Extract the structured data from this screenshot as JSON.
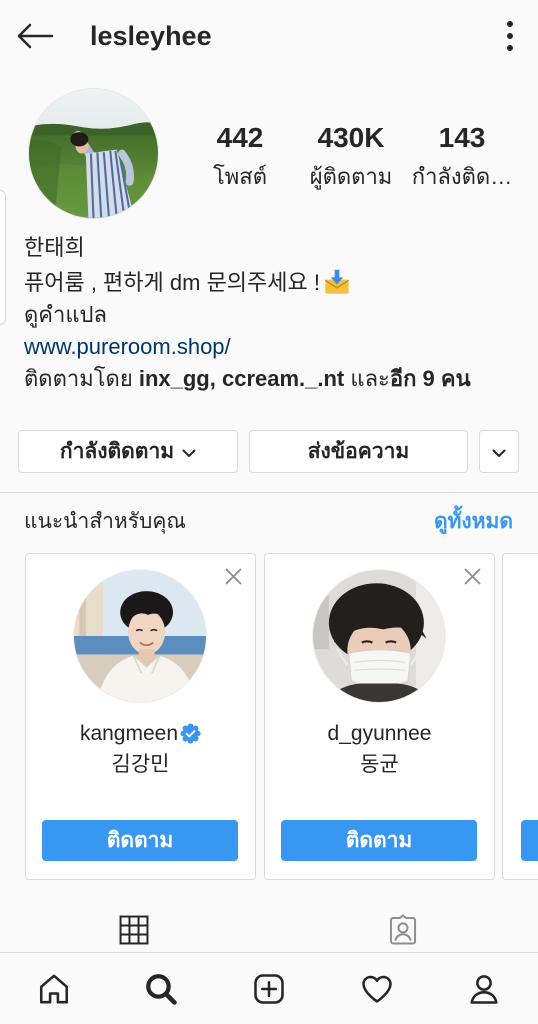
{
  "header": {
    "back_icon": "arrow-left-icon",
    "username": "lesleyhee",
    "menu_icon": "more-vertical-icon"
  },
  "profile": {
    "stats": [
      {
        "value": "442",
        "label": "โพสต์"
      },
      {
        "value": "430K",
        "label": "ผู้ติดตาม"
      },
      {
        "value": "143",
        "label": "กำลังติด…"
      }
    ],
    "bio": {
      "name": "한태희",
      "text": "퓨어룸 , 편하게 dm 문의주세요 !",
      "emoji_icon": "envelope-with-arrow-icon",
      "translate": "ดูคำแปล",
      "website": "www.pureroom.shop/"
    },
    "followed_by": {
      "prefix": "ติดตามโดย",
      "names": "inx_gg, ccream._.nt",
      "conjunction": "และ",
      "others": "อีก 9 คน"
    }
  },
  "actions": {
    "following_label": "กำลังติดตาม",
    "following_icon": "chevron-down-icon",
    "message_label": "ส่งข้อความ",
    "more_icon": "chevron-down-icon"
  },
  "suggestions": {
    "title": "แนะนำสำหรับคุณ",
    "see_all": "ดูทั้งหมด",
    "cards": [
      {
        "username": "kangmeen",
        "verified": true,
        "name": "김강민",
        "button": "ติดตาม"
      },
      {
        "username": "d_gyunnee",
        "verified": false,
        "name": "동균",
        "button": "ติดตาม"
      }
    ]
  },
  "tabs": [
    {
      "icon": "grid-icon",
      "active": true
    },
    {
      "icon": "tagged-icon",
      "active": false
    }
  ],
  "bottom_nav": [
    {
      "icon": "home-icon",
      "active": false
    },
    {
      "icon": "search-icon",
      "active": true
    },
    {
      "icon": "add-icon",
      "active": false
    },
    {
      "icon": "heart-icon",
      "active": false
    },
    {
      "icon": "profile-icon",
      "active": false
    }
  ],
  "colors": {
    "background": "#fafafa",
    "text": "#262626",
    "accent": "#3897f0",
    "link": "#003569",
    "border": "#dbdbdb",
    "muted_icon": "#8e8e8e"
  }
}
